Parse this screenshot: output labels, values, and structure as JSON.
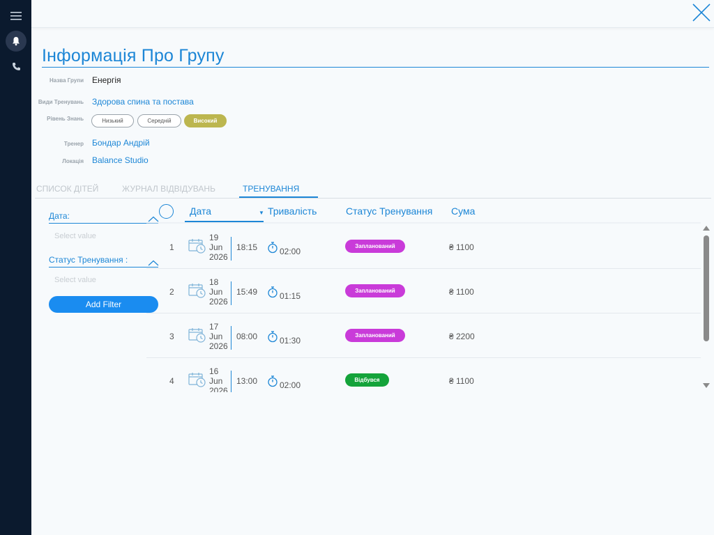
{
  "group": {
    "title": "Інформація Про Групу",
    "fields": {
      "name_label": "Назва Групи",
      "name_value": "Енергія",
      "types_label": "Види Тренувань",
      "types_value": "Здорова спина та постава",
      "level_label": "Рівень Знань",
      "levels": [
        "Низький",
        "Середній",
        "Високий"
      ],
      "level_selected": "Високий",
      "trainer_label": "Тренер",
      "trainer_value": "Бондар Андрій",
      "location_label": "Локація",
      "location_value": "Balance Studio"
    }
  },
  "tabs": [
    {
      "label": "СПИСОК ДІТЕЙ",
      "active": false
    },
    {
      "label": "ЖУРНАЛ ВІДВІДУВАНЬ",
      "active": false
    },
    {
      "label": "ТРЕНУВАННЯ",
      "active": true
    }
  ],
  "filters": {
    "date_label": "Дата:",
    "date_placeholder": "Select value",
    "status_label": "Статус Тренування :",
    "status_placeholder": "Select value",
    "add_button": "Add Filter"
  },
  "table": {
    "columns": {
      "date": "Дата",
      "duration": "Тривалість",
      "status": "Статус Тренування",
      "sum": "Сума"
    },
    "rows": [
      {
        "num": "1",
        "day": "19",
        "month": "Jun",
        "year": "2026",
        "time": "18:15",
        "duration": "02:00",
        "status": "Запланований",
        "status_kind": "planned",
        "sum": "₴ 1100"
      },
      {
        "num": "2",
        "day": "18",
        "month": "Jun",
        "year": "2026",
        "time": "15:49",
        "duration": "01:15",
        "status": "Запланований",
        "status_kind": "planned",
        "sum": "₴ 1100"
      },
      {
        "num": "3",
        "day": "17",
        "month": "Jun",
        "year": "2026",
        "time": "08:00",
        "duration": "01:30",
        "status": "Запланований",
        "status_kind": "planned",
        "sum": "₴ 2200"
      },
      {
        "num": "4",
        "day": "16",
        "month": "Jun",
        "year": "2026",
        "time": "13:00",
        "duration": "02:00",
        "status": "Відбувся",
        "status_kind": "done",
        "sum": "₴ 1100"
      }
    ]
  },
  "colors": {
    "accent": "#1c86d6",
    "sidebar": "#0b1a2e",
    "level_active": "#bcb64f",
    "status_planned": "#c93bd9",
    "status_done": "#14a33a",
    "add_button": "#1a8cf0"
  },
  "icons": {
    "sidebar": [
      "menu-icon",
      "bell-icon",
      "phone-icon"
    ],
    "close": "close-icon",
    "row_date": "calendar-clock-icon",
    "row_duration": "stopwatch-icon"
  }
}
